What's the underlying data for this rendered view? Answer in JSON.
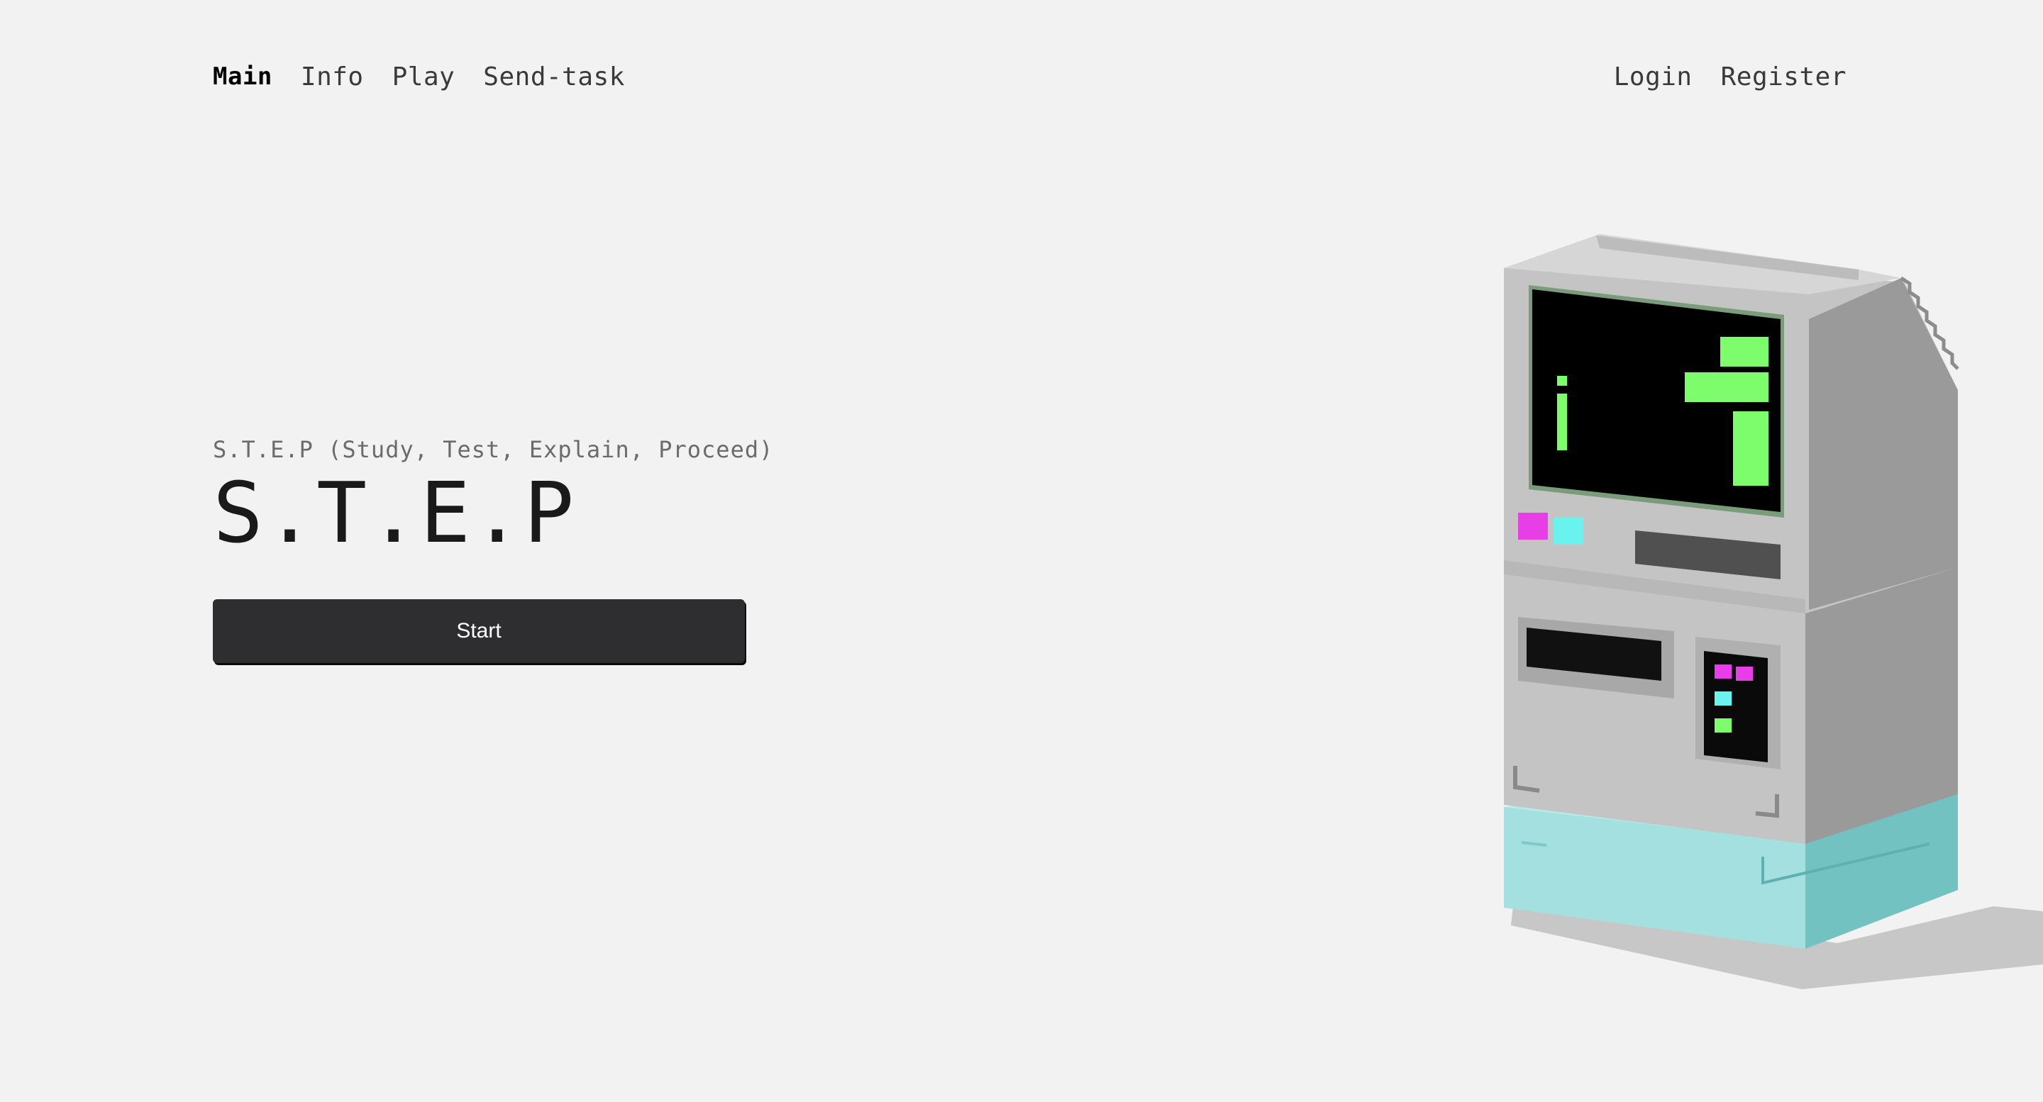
{
  "nav": {
    "left": [
      {
        "label": "Main",
        "active": true
      },
      {
        "label": "Info",
        "active": false
      },
      {
        "label": "Play",
        "active": false
      },
      {
        "label": "Send-task",
        "active": false
      }
    ],
    "right": [
      {
        "label": "Login"
      },
      {
        "label": "Register"
      }
    ]
  },
  "hero": {
    "subtitle": "S.T.E.P (Study, Test, Explain, Proceed)",
    "title": "S.T.E.P",
    "start_label": "Start"
  },
  "illustration": {
    "icon": "retro-computer-icon",
    "colors": {
      "body": "#c4c4c4",
      "side": "#9a9a9a",
      "screen": "#000000",
      "screen_glyph": "#7dfc6c",
      "accent_magenta": "#e83ee8",
      "accent_cyan": "#6af3ee",
      "base": "#a4e0df",
      "base_side": "#72c2c2",
      "background": "#f2f2f2"
    }
  }
}
